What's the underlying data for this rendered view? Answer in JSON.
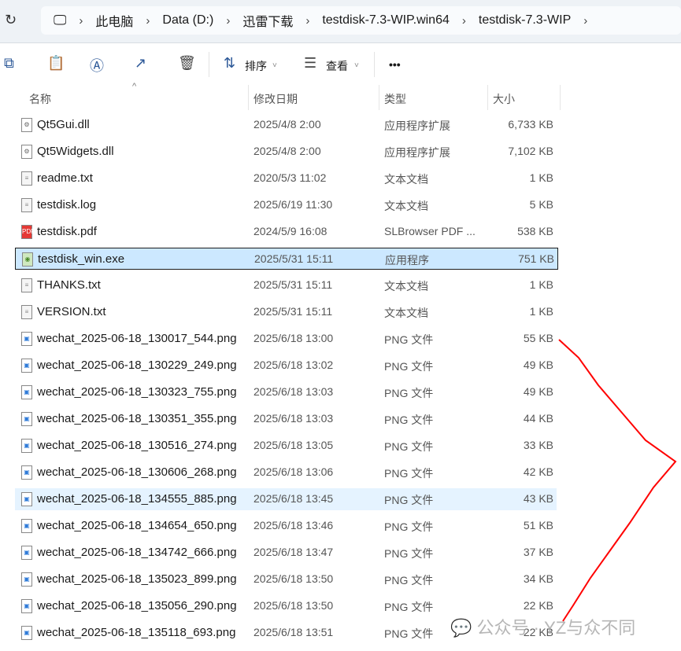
{
  "address": {
    "breadcrumbs": [
      "此电脑",
      "Data (D:)",
      "迅雷下载",
      "testdisk-7.3-WIP.win64",
      "testdisk-7.3-WIP"
    ]
  },
  "toolbar": {
    "sort_label": "排序",
    "view_label": "查看",
    "more_label": "•••"
  },
  "columns": {
    "name": "名称",
    "date": "修改日期",
    "type": "类型",
    "size": "大小"
  },
  "files": [
    {
      "name": "Qt5Gui.dll",
      "date": "2025/4/8 2:00",
      "type": "应用程序扩展",
      "size": "6,733 KB",
      "icon": "dll"
    },
    {
      "name": "Qt5Widgets.dll",
      "date": "2025/4/8 2:00",
      "type": "应用程序扩展",
      "size": "7,102 KB",
      "icon": "dll"
    },
    {
      "name": "readme.txt",
      "date": "2020/5/3 11:02",
      "type": "文本文档",
      "size": "1 KB",
      "icon": "txt"
    },
    {
      "name": "testdisk.log",
      "date": "2025/6/19 11:30",
      "type": "文本文档",
      "size": "5 KB",
      "icon": "txt"
    },
    {
      "name": "testdisk.pdf",
      "date": "2024/5/9 16:08",
      "type": "SLBrowser PDF ...",
      "size": "538 KB",
      "icon": "pdf"
    },
    {
      "name": "testdisk_win.exe",
      "date": "2025/5/31 15:11",
      "type": "应用程序",
      "size": "751 KB",
      "icon": "exe"
    },
    {
      "name": "THANKS.txt",
      "date": "2025/5/31 15:11",
      "type": "文本文档",
      "size": "1 KB",
      "icon": "txt"
    },
    {
      "name": "VERSION.txt",
      "date": "2025/5/31 15:11",
      "type": "文本文档",
      "size": "1 KB",
      "icon": "txt"
    },
    {
      "name": "wechat_2025-06-18_130017_544.png",
      "date": "2025/6/18 13:00",
      "type": "PNG 文件",
      "size": "55 KB",
      "icon": "png"
    },
    {
      "name": "wechat_2025-06-18_130229_249.png",
      "date": "2025/6/18 13:02",
      "type": "PNG 文件",
      "size": "49 KB",
      "icon": "png"
    },
    {
      "name": "wechat_2025-06-18_130323_755.png",
      "date": "2025/6/18 13:03",
      "type": "PNG 文件",
      "size": "49 KB",
      "icon": "png"
    },
    {
      "name": "wechat_2025-06-18_130351_355.png",
      "date": "2025/6/18 13:03",
      "type": "PNG 文件",
      "size": "44 KB",
      "icon": "png"
    },
    {
      "name": "wechat_2025-06-18_130516_274.png",
      "date": "2025/6/18 13:05",
      "type": "PNG 文件",
      "size": "33 KB",
      "icon": "png"
    },
    {
      "name": "wechat_2025-06-18_130606_268.png",
      "date": "2025/6/18 13:06",
      "type": "PNG 文件",
      "size": "42 KB",
      "icon": "png"
    },
    {
      "name": "wechat_2025-06-18_134555_885.png",
      "date": "2025/6/18 13:45",
      "type": "PNG 文件",
      "size": "43 KB",
      "icon": "png"
    },
    {
      "name": "wechat_2025-06-18_134654_650.png",
      "date": "2025/6/18 13:46",
      "type": "PNG 文件",
      "size": "51 KB",
      "icon": "png"
    },
    {
      "name": "wechat_2025-06-18_134742_666.png",
      "date": "2025/6/18 13:47",
      "type": "PNG 文件",
      "size": "37 KB",
      "icon": "png"
    },
    {
      "name": "wechat_2025-06-18_135023_899.png",
      "date": "2025/6/18 13:50",
      "type": "PNG 文件",
      "size": "34 KB",
      "icon": "png"
    },
    {
      "name": "wechat_2025-06-18_135056_290.png",
      "date": "2025/6/18 13:50",
      "type": "PNG 文件",
      "size": "22 KB",
      "icon": "png"
    },
    {
      "name": "wechat_2025-06-18_135118_693.png",
      "date": "2025/6/18 13:51",
      "type": "PNG 文件",
      "size": "22 KB",
      "icon": "png"
    }
  ],
  "selected_index": 5,
  "hover_index": 14,
  "watermark": "公众号 · YZ与众不同",
  "annotation_color": "#ff0000"
}
